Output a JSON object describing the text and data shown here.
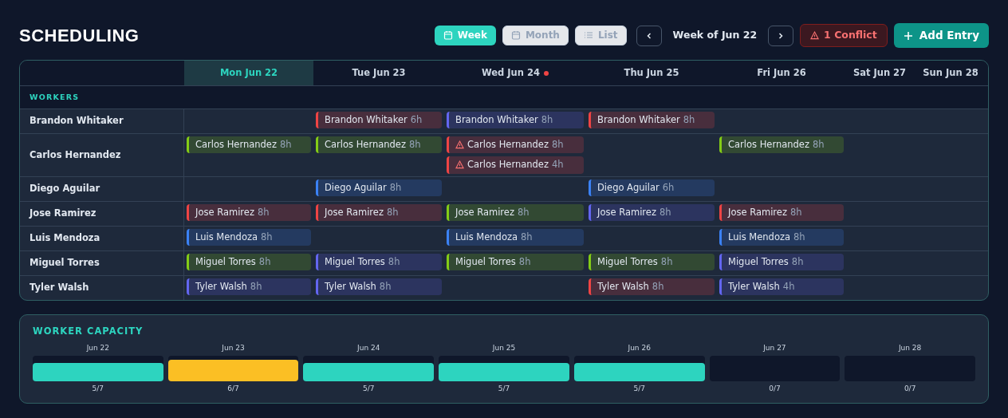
{
  "title": "SCHEDULING",
  "views": [
    {
      "label": "Week",
      "selected": true
    },
    {
      "label": "Month",
      "selected": false
    },
    {
      "label": "List",
      "selected": false
    }
  ],
  "period": "Week of Jun 22",
  "conflict_button": "1 Conflict",
  "add_button": "Add Entry",
  "days": [
    {
      "label": "Mon Jun 22",
      "selected": true,
      "conflict": false
    },
    {
      "label": "Tue Jun 23",
      "selected": false,
      "conflict": false
    },
    {
      "label": "Wed Jun 24",
      "selected": false,
      "conflict": true
    },
    {
      "label": "Thu Jun 25",
      "selected": false,
      "conflict": false
    },
    {
      "label": "Fri Jun 26",
      "selected": false,
      "conflict": false
    },
    {
      "label": "Sat Jun 27",
      "selected": false,
      "conflict": false
    },
    {
      "label": "Sun Jun 28",
      "selected": false,
      "conflict": false
    }
  ],
  "section_label": "WORKERS",
  "workers": [
    {
      "name": "Brandon Whitaker",
      "shifts": {
        "tue": [
          {
            "name": "Brandon Whitaker",
            "hours": "6h",
            "color": "#ef4444",
            "conflict": false
          }
        ],
        "wed": [
          {
            "name": "Brandon Whitaker",
            "hours": "8h",
            "color": "#6366f1",
            "conflict": false
          }
        ],
        "thu": [
          {
            "name": "Brandon Whitaker",
            "hours": "8h",
            "color": "#ef4444",
            "conflict": false
          }
        ]
      }
    },
    {
      "name": "Carlos Hernandez",
      "shifts": {
        "mon": [
          {
            "name": "Carlos Hernandez",
            "hours": "8h",
            "color": "#84cc16",
            "conflict": false
          }
        ],
        "tue": [
          {
            "name": "Carlos Hernandez",
            "hours": "8h",
            "color": "#84cc16",
            "conflict": false
          }
        ],
        "wed": [
          {
            "name": "Carlos Hernandez",
            "hours": "8h",
            "color": "#ef4444",
            "conflict": true
          },
          {
            "name": "Carlos Hernandez",
            "hours": "4h",
            "color": "#ef4444",
            "conflict": true
          }
        ],
        "fri": [
          {
            "name": "Carlos Hernandez",
            "hours": "8h",
            "color": "#84cc16",
            "conflict": false
          }
        ]
      }
    },
    {
      "name": "Diego Aguilar",
      "shifts": {
        "tue": [
          {
            "name": "Diego Aguilar",
            "hours": "8h",
            "color": "#3b82f6",
            "conflict": false
          }
        ],
        "thu": [
          {
            "name": "Diego Aguilar",
            "hours": "6h",
            "color": "#3b82f6",
            "conflict": false
          }
        ]
      }
    },
    {
      "name": "Jose Ramirez",
      "shifts": {
        "mon": [
          {
            "name": "Jose Ramirez",
            "hours": "8h",
            "color": "#ef4444",
            "conflict": false
          }
        ],
        "tue": [
          {
            "name": "Jose Ramirez",
            "hours": "8h",
            "color": "#ef4444",
            "conflict": false
          }
        ],
        "wed": [
          {
            "name": "Jose Ramirez",
            "hours": "8h",
            "color": "#84cc16",
            "conflict": false
          }
        ],
        "thu": [
          {
            "name": "Jose Ramirez",
            "hours": "8h",
            "color": "#6366f1",
            "conflict": false
          }
        ],
        "fri": [
          {
            "name": "Jose Ramirez",
            "hours": "8h",
            "color": "#ef4444",
            "conflict": false
          }
        ]
      }
    },
    {
      "name": "Luis Mendoza",
      "shifts": {
        "mon": [
          {
            "name": "Luis Mendoza",
            "hours": "8h",
            "color": "#3b82f6",
            "conflict": false
          }
        ],
        "wed": [
          {
            "name": "Luis Mendoza",
            "hours": "8h",
            "color": "#3b82f6",
            "conflict": false
          }
        ],
        "fri": [
          {
            "name": "Luis Mendoza",
            "hours": "8h",
            "color": "#3b82f6",
            "conflict": false
          }
        ]
      }
    },
    {
      "name": "Miguel Torres",
      "shifts": {
        "mon": [
          {
            "name": "Miguel Torres",
            "hours": "8h",
            "color": "#84cc16",
            "conflict": false
          }
        ],
        "tue": [
          {
            "name": "Miguel Torres",
            "hours": "8h",
            "color": "#6366f1",
            "conflict": false
          }
        ],
        "wed": [
          {
            "name": "Miguel Torres",
            "hours": "8h",
            "color": "#84cc16",
            "conflict": false
          }
        ],
        "thu": [
          {
            "name": "Miguel Torres",
            "hours": "8h",
            "color": "#84cc16",
            "conflict": false
          }
        ],
        "fri": [
          {
            "name": "Miguel Torres",
            "hours": "8h",
            "color": "#6366f1",
            "conflict": false
          }
        ]
      }
    },
    {
      "name": "Tyler Walsh",
      "shifts": {
        "mon": [
          {
            "name": "Tyler Walsh",
            "hours": "8h",
            "color": "#6366f1",
            "conflict": false
          }
        ],
        "tue": [
          {
            "name": "Tyler Walsh",
            "hours": "8h",
            "color": "#6366f1",
            "conflict": false
          }
        ],
        "thu": [
          {
            "name": "Tyler Walsh",
            "hours": "8h",
            "color": "#ef4444",
            "conflict": false
          }
        ],
        "fri": [
          {
            "name": "Tyler Walsh",
            "hours": "4h",
            "color": "#6366f1",
            "conflict": false
          }
        ]
      }
    }
  ],
  "capacity": {
    "title": "WORKER CAPACITY",
    "days": [
      {
        "label": "Jun 22",
        "kind": "normal",
        "color": "#2dd4bf",
        "reading": "5/7"
      },
      {
        "label": "Jun 23",
        "kind": "high",
        "color": "#fbbf24",
        "reading": "6/7"
      },
      {
        "label": "Jun 24",
        "kind": "normal",
        "color": "#2dd4bf",
        "reading": "5/7"
      },
      {
        "label": "Jun 25",
        "kind": "normal",
        "color": "#2dd4bf",
        "reading": "5/7"
      },
      {
        "label": "Jun 26",
        "kind": "normal",
        "color": "#2dd4bf",
        "reading": "5/7"
      },
      {
        "label": "Jun 27",
        "kind": "empty",
        "reading": "0/7"
      },
      {
        "label": "Jun 28",
        "kind": "empty",
        "reading": "0/7"
      }
    ]
  }
}
